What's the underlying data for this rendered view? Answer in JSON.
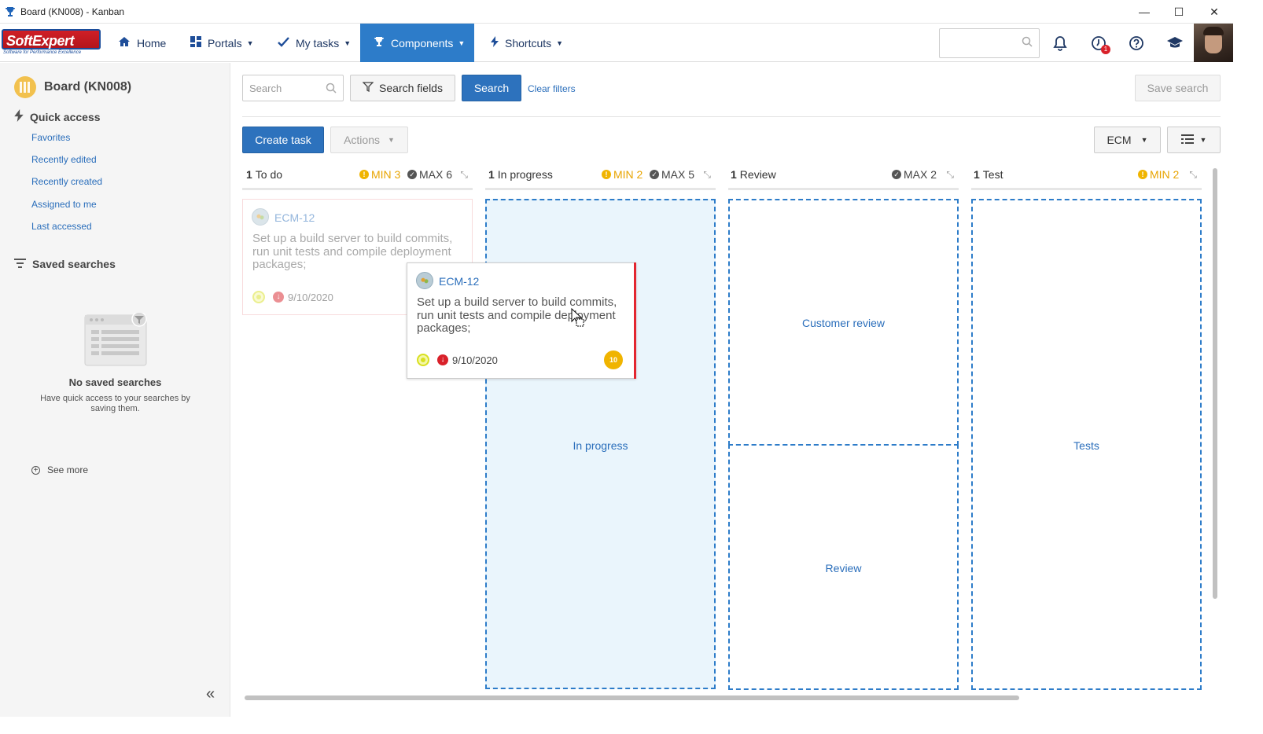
{
  "window": {
    "title": "Board (KN008) - Kanban",
    "controls": {
      "minimize": "—",
      "maximize": "☐",
      "close": "✕"
    }
  },
  "nav": {
    "logo": {
      "name": "SoftExpert",
      "tagline": "Software for Performance Excellence"
    },
    "items": [
      {
        "label": "Home",
        "icon": "home-icon"
      },
      {
        "label": "Portals",
        "icon": "portals-icon"
      },
      {
        "label": "My tasks",
        "icon": "check-icon"
      },
      {
        "label": "Components",
        "icon": "trophy-icon",
        "active": true
      },
      {
        "label": "Shortcuts",
        "icon": "bolt-icon"
      }
    ],
    "notifications_badge": "1",
    "accent": "#2d7cc9"
  },
  "sidebar": {
    "title": "Board (KN008)",
    "quick_access": {
      "title": "Quick access",
      "links": [
        "Favorites",
        "Recently edited",
        "Recently created",
        "Assigned to me",
        "Last accessed"
      ]
    },
    "saved_searches": {
      "title": "Saved searches",
      "empty_title": "No saved searches",
      "empty_text": "Have quick access to your searches by saving them.",
      "see_more": "See more"
    }
  },
  "toolbar": {
    "search_placeholder": "Search",
    "search_fields": "Search fields",
    "search": "Search",
    "clear_filters": "Clear filters",
    "save_search": "Save search",
    "create_task": "Create task",
    "actions": "Actions",
    "project_filter": "ECM"
  },
  "columns": [
    {
      "count": "1",
      "name": "To do",
      "min": "MIN 3",
      "max": "MAX 6"
    },
    {
      "count": "1",
      "name": "In progress",
      "min": "MIN 2",
      "max": "MAX 5",
      "zone": "In progress"
    },
    {
      "count": "1",
      "name": "Review",
      "max": "MAX 2",
      "zones": [
        "Customer review",
        "Review"
      ]
    },
    {
      "count": "1",
      "name": "Test",
      "min": "MIN 2",
      "zone": "Tests"
    }
  ],
  "card": {
    "code": "ECM-12",
    "description": "Set up a build server to build commits, run unit tests and compile deployment packages;",
    "date": "9/10/2020",
    "points": "10",
    "priority_color": "#e32630"
  }
}
